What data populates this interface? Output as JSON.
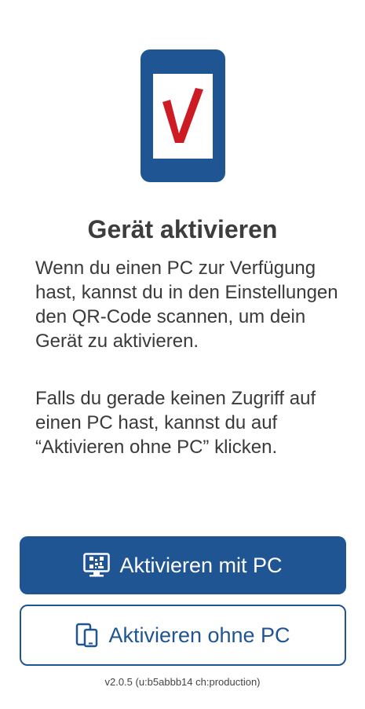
{
  "colors": {
    "brand_blue": "#1f5592",
    "check_red": "#cc1b22",
    "text_dark": "#3a3a3a",
    "background": "#ffffff"
  },
  "logo": {
    "icon": "phone-checkmark-icon"
  },
  "title": "Gerät aktivieren",
  "paragraphs": {
    "first": "Wenn du einen PC zur Verfügung hast, kannst du in den Einstellungen den QR-Code scannen, um dein Gerät zu aktivieren.",
    "second": "Falls du gerade keinen Zugriff auf einen PC hast, kannst du auf “Aktivieren ohne PC” klicken."
  },
  "buttons": {
    "with_pc": {
      "label": "Aktivieren mit PC",
      "icon": "monitor-qr-icon"
    },
    "without_pc": {
      "label": "Aktivieren ohne PC",
      "icon": "devices-icon"
    }
  },
  "version": "v2.0.5 (u:b5abbb14 ch:production)"
}
